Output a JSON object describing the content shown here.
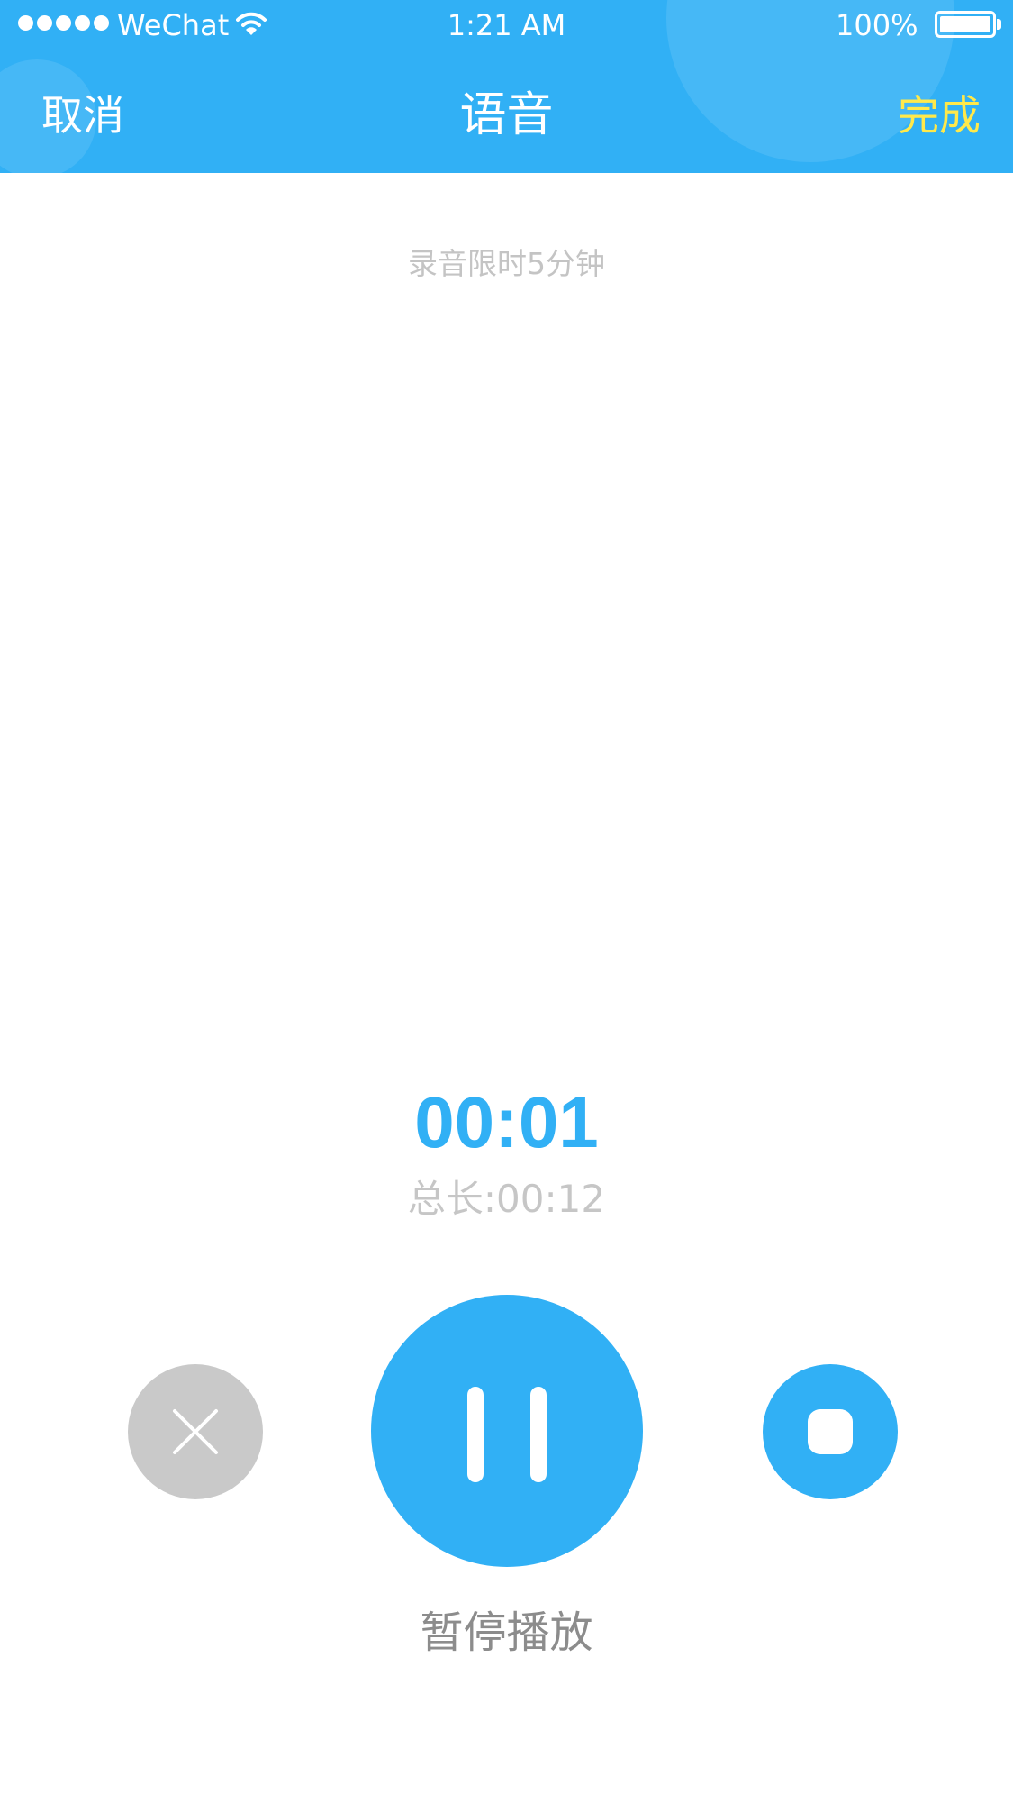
{
  "colors": {
    "accent": "#31b0f5",
    "done": "#ffe94a",
    "cancel_button": "#c9c9c9",
    "hint_text": "#c4c4c4",
    "label_text": "#8c8c8c"
  },
  "status_bar": {
    "carrier": "WeChat",
    "time": "1:21 AM",
    "battery": "100%",
    "battery_level": 1.0,
    "signal_icon": "signal-dots-icon",
    "wifi_icon": "wifi-icon"
  },
  "nav": {
    "cancel_label": "取消",
    "title": "语音",
    "done_label": "完成"
  },
  "recorder": {
    "hint": "录音限时5分钟",
    "elapsed": "00:01",
    "total": "总长:00:12",
    "action_label": "暂停播放",
    "cancel_icon": "close-icon",
    "pause_icon": "pause-icon",
    "stop_icon": "stop-icon"
  }
}
